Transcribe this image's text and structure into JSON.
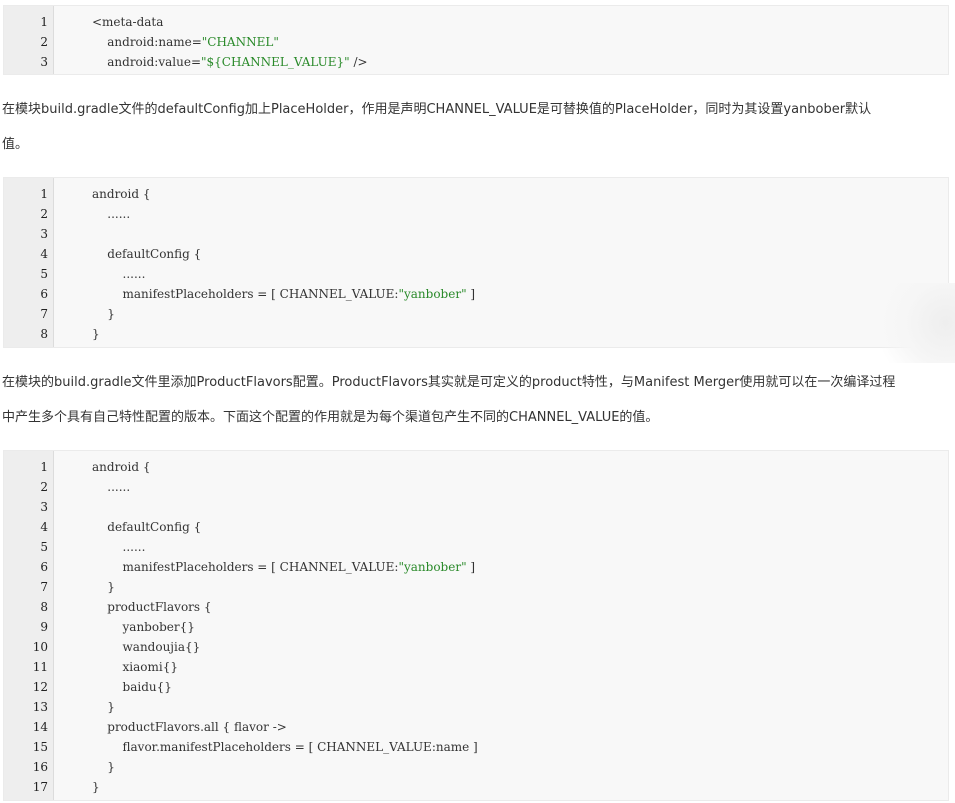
{
  "code_block_1": {
    "lines": [
      {
        "n": "1",
        "pre": "<meta-data",
        "str": "",
        "post": ""
      },
      {
        "n": "2",
        "pre": "    android:name=",
        "str": "\"CHANNEL\"",
        "post": ""
      },
      {
        "n": "3",
        "pre": "    android:value=",
        "str": "\"${CHANNEL_VALUE}\"",
        "post": " />"
      }
    ]
  },
  "paragraph_1": {
    "line1": "在模块build.gradle文件的defaultConfig加上PlaceHolder，作用是声明CHANNEL_VALUE是可替换值的PlaceHolder，同时为其设置yanbober默认",
    "line2": "值。"
  },
  "code_block_2": {
    "lines": [
      {
        "n": "1",
        "pre": "android {",
        "str": "",
        "post": ""
      },
      {
        "n": "2",
        "pre": "    ......",
        "str": "",
        "post": ""
      },
      {
        "n": "3",
        "pre": "",
        "str": "",
        "post": ""
      },
      {
        "n": "4",
        "pre": "    defaultConfig {",
        "str": "",
        "post": ""
      },
      {
        "n": "5",
        "pre": "        ......",
        "str": "",
        "post": ""
      },
      {
        "n": "6",
        "pre": "        manifestPlaceholders = [ CHANNEL_VALUE:",
        "str": "\"yanbober\"",
        "post": " ]"
      },
      {
        "n": "7",
        "pre": "    }",
        "str": "",
        "post": ""
      },
      {
        "n": "8",
        "pre": "}",
        "str": "",
        "post": ""
      }
    ]
  },
  "paragraph_2": {
    "line1": "在模块的build.gradle文件里添加ProductFlavors配置。ProductFlavors其实就是可定义的product特性，与Manifest Merger使用就可以在一次编译过程",
    "line2": "中产生多个具有自己特性配置的版本。下面这个配置的作用就是为每个渠道包产生不同的CHANNEL_VALUE的值。"
  },
  "code_block_3": {
    "lines": [
      {
        "n": "1",
        "pre": "android {",
        "str": "",
        "post": ""
      },
      {
        "n": "2",
        "pre": "    ......",
        "str": "",
        "post": ""
      },
      {
        "n": "3",
        "pre": "",
        "str": "",
        "post": ""
      },
      {
        "n": "4",
        "pre": "    defaultConfig {",
        "str": "",
        "post": ""
      },
      {
        "n": "5",
        "pre": "        ......",
        "str": "",
        "post": ""
      },
      {
        "n": "6",
        "pre": "        manifestPlaceholders = [ CHANNEL_VALUE:",
        "str": "\"yanbober\"",
        "post": " ]"
      },
      {
        "n": "7",
        "pre": "    }",
        "str": "",
        "post": ""
      },
      {
        "n": "8",
        "pre": "    productFlavors {",
        "str": "",
        "post": ""
      },
      {
        "n": "9",
        "pre": "        yanbober{}",
        "str": "",
        "post": ""
      },
      {
        "n": "10",
        "pre": "        wandoujia{}",
        "str": "",
        "post": ""
      },
      {
        "n": "11",
        "pre": "        xiaomi{}",
        "str": "",
        "post": ""
      },
      {
        "n": "12",
        "pre": "        baidu{}",
        "str": "",
        "post": ""
      },
      {
        "n": "13",
        "pre": "    }",
        "str": "",
        "post": ""
      },
      {
        "n": "14",
        "pre": "    productFlavors.all { flavor ->",
        "str": "",
        "post": ""
      },
      {
        "n": "15",
        "pre": "        flavor.manifestPlaceholders = [ CHANNEL_VALUE:name ]",
        "str": "",
        "post": ""
      },
      {
        "n": "16",
        "pre": "    }",
        "str": "",
        "post": ""
      },
      {
        "n": "17",
        "pre": "}",
        "str": "",
        "post": ""
      }
    ]
  },
  "colors": {
    "string_literal": "#2a8a2a",
    "code_background": "#f8f8f8",
    "gutter_background": "#eeeeee",
    "text": "#333333"
  }
}
